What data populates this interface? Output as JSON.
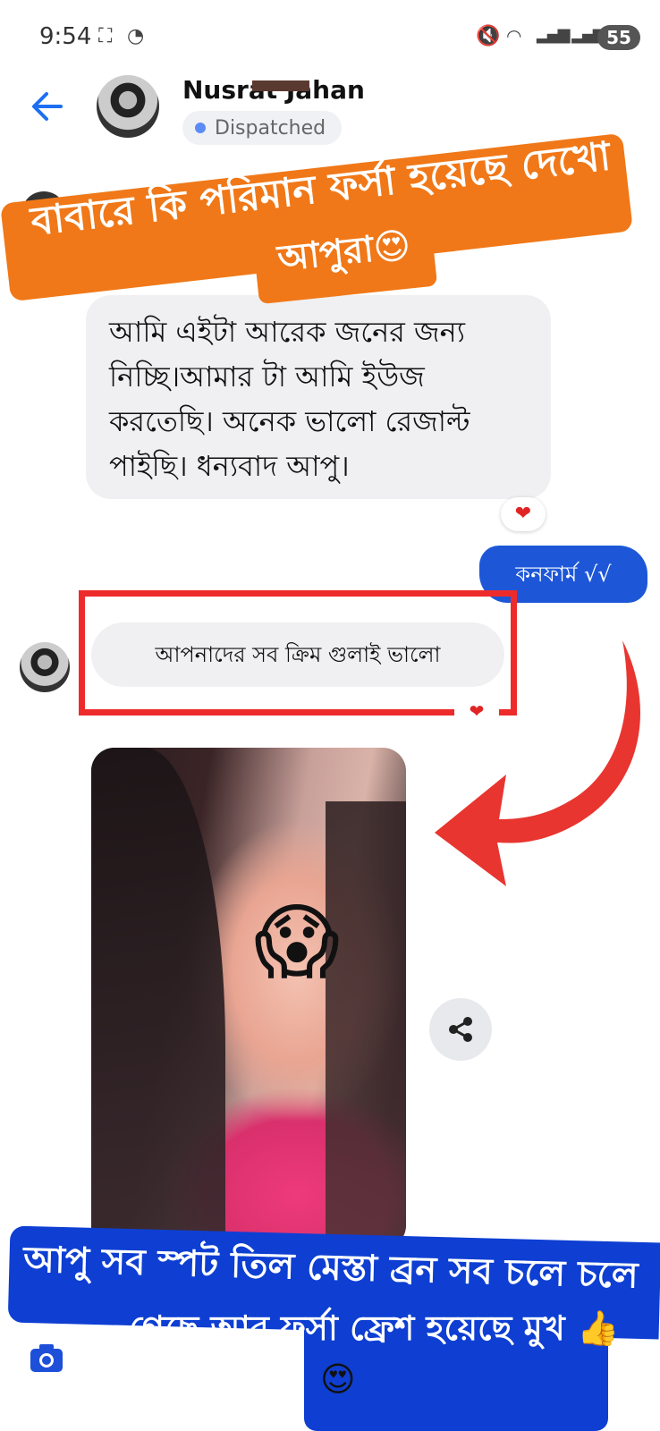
{
  "status_bar": {
    "time": "9:54",
    "battery": "55"
  },
  "header": {
    "contact_name": "Nusrat Jahan",
    "status": "Dispatched"
  },
  "overlay_top": {
    "line1": "বাবারে কি পরিমান ফর্সা হয়েছে দেখো",
    "line2": "আপুরা😍"
  },
  "messages": {
    "incoming_1": "আমি  এইটা আরেক জনের জন্য নিচ্ছি।আমার টা আমি ইউজ করতেছি। অনেক ভালো রেজাল্ট পাইছি। ধন্যবাদ আপু।",
    "outgoing_1": "কনফার্ম √√",
    "incoming_2": "আপনাদের সব ক্রিম  গুলাই ভালো"
  },
  "overlay_bottom": {
    "line1": "আপু সব স্পট তিল মেস্তা ব্রন সব চলে চলে",
    "line2": "গেছে আর ফর্সা ফ্রেশ হয়েছে মুখ 👍",
    "emoji": "😍"
  },
  "photo_emoji": "😱",
  "icons": [
    "back-arrow-icon",
    "share-icon",
    "camera-icon",
    "heart-reaction-icon"
  ],
  "colors": {
    "accent_blue": "#1d57d8",
    "overlay_orange": "#f07818",
    "frame_red": "#ee2b2b"
  }
}
